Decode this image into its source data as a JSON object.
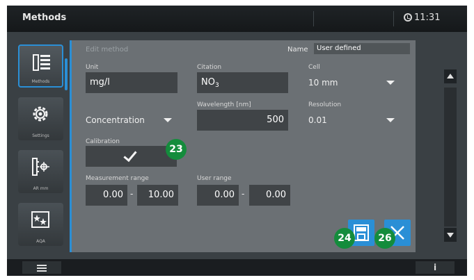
{
  "titlebar": {
    "title": "Methods",
    "time": "11:31"
  },
  "sidebar": {
    "items": [
      {
        "label": "Methods",
        "icon": "list-icon",
        "active": true
      },
      {
        "label": "Settings",
        "icon": "gear-icon",
        "active": false
      },
      {
        "label": "AR mm",
        "icon": "ruler-target-icon",
        "active": false
      },
      {
        "label": "AQA",
        "icon": "stars-icon",
        "active": false
      }
    ]
  },
  "panel": {
    "header": "Edit method",
    "name_label": "Name",
    "name_value": "User defined",
    "unit": {
      "label": "Unit",
      "value": "mg/l"
    },
    "citation": {
      "label": "Citation",
      "value": "NO",
      "sub": "3"
    },
    "cell": {
      "label": "Cell",
      "value": "10 mm"
    },
    "mode": {
      "value": "Concentration"
    },
    "wavelength": {
      "label": "Wavelength [nm]",
      "value": "500"
    },
    "resolution": {
      "label": "Resolution",
      "value": "0.01"
    },
    "calibration": {
      "label": "Calibration",
      "checked": true
    },
    "measurement_range": {
      "label": "Measurement range",
      "min": "0.00",
      "max": "10.00"
    },
    "user_range": {
      "label": "User range",
      "min": "0.00",
      "max": "0.00"
    }
  },
  "badges": {
    "calibration": "23",
    "save": "24",
    "cancel": "26"
  },
  "colors": {
    "accent": "#2a8fd6",
    "badge": "#148c3c",
    "panel": "#6b7074",
    "field": "#404447"
  },
  "bottombar": {
    "info_label": "i"
  }
}
